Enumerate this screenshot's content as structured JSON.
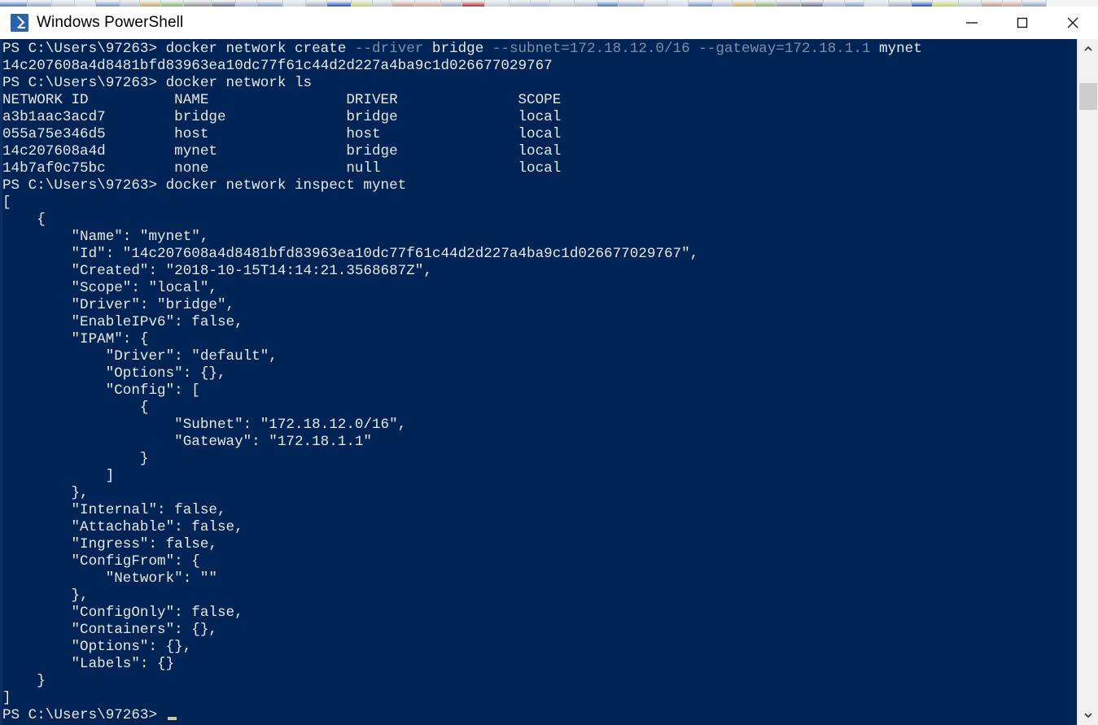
{
  "window": {
    "title": "Windows PowerShell",
    "icon": "powershell-icon",
    "controls": {
      "minimize": "minimize-icon",
      "maximize": "maximize-icon",
      "close": "close-icon"
    }
  },
  "theme": {
    "console_bg": "#012456",
    "console_fg": "#e8e8e8",
    "dim_fg": "#7d8fa8",
    "cursor": "#d6c79a",
    "titlebar_bg": "#ffffff",
    "scrollbar_bg": "#f0f0f0",
    "scrollbar_thumb": "#cdcdcd"
  },
  "scrollbar": {
    "up_arrow": "chevron-up-icon",
    "down_arrow": "chevron-down-icon",
    "thumb_position_percent": 4
  },
  "console": {
    "prompt": "PS C:\\Users\\97263>",
    "cursor_visible": true,
    "lines": [
      {
        "id": "cmd-create",
        "segments": [
          {
            "text": "PS C:\\Users\\97263> docker network create ",
            "style": "normal"
          },
          {
            "text": "--driver",
            "style": "dim"
          },
          {
            "text": " bridge ",
            "style": "normal"
          },
          {
            "text": "--subnet=172.18.12.0/16",
            "style": "dim"
          },
          {
            "text": " ",
            "style": "normal"
          },
          {
            "text": "--gateway=172.18.1.1",
            "style": "dim"
          },
          {
            "text": " mynet",
            "style": "normal"
          }
        ]
      },
      {
        "id": "created-id",
        "text": "14c207608a4d8481bfd83963ea10dc77f61c44d2d227a4ba9c1d026677029767"
      },
      {
        "id": "cmd-ls",
        "text": "PS C:\\Users\\97263> docker network ls"
      },
      {
        "id": "ls-header",
        "text": "NETWORK ID          NAME                DRIVER              SCOPE"
      },
      {
        "id": "ls-row-bridge",
        "text": "a3b1aac3acd7        bridge              bridge              local"
      },
      {
        "id": "ls-row-host",
        "text": "055a75e346d5        host                host                local"
      },
      {
        "id": "ls-row-mynet",
        "text": "14c207608a4d        mynet               bridge              local"
      },
      {
        "id": "ls-row-none",
        "text": "14b7af0c75bc        none                null                local"
      },
      {
        "id": "cmd-inspect",
        "text": "PS C:\\Users\\97263> docker network inspect mynet"
      },
      {
        "id": "json-open-array",
        "text": "["
      },
      {
        "id": "json-open-obj",
        "text": "    {"
      },
      {
        "id": "json-name",
        "text": "        \"Name\": \"mynet\","
      },
      {
        "id": "json-id",
        "text": "        \"Id\": \"14c207608a4d8481bfd83963ea10dc77f61c44d2d227a4ba9c1d026677029767\","
      },
      {
        "id": "json-created",
        "text": "        \"Created\": \"2018-10-15T14:14:21.3568687Z\","
      },
      {
        "id": "json-scope",
        "text": "        \"Scope\": \"local\","
      },
      {
        "id": "json-driver",
        "text": "        \"Driver\": \"bridge\","
      },
      {
        "id": "json-enableipv6",
        "text": "        \"EnableIPv6\": false,"
      },
      {
        "id": "json-ipam-open",
        "text": "        \"IPAM\": {"
      },
      {
        "id": "json-ipam-driver",
        "text": "            \"Driver\": \"default\","
      },
      {
        "id": "json-ipam-options",
        "text": "            \"Options\": {},"
      },
      {
        "id": "json-config-open",
        "text": "            \"Config\": ["
      },
      {
        "id": "json-config-obj-open",
        "text": "                {"
      },
      {
        "id": "json-subnet",
        "text": "                    \"Subnet\": \"172.18.12.0/16\","
      },
      {
        "id": "json-gateway",
        "text": "                    \"Gateway\": \"172.18.1.1\""
      },
      {
        "id": "json-config-obj-close",
        "text": "                }"
      },
      {
        "id": "json-config-close",
        "text": "            ]"
      },
      {
        "id": "json-ipam-close",
        "text": "        },"
      },
      {
        "id": "json-internal",
        "text": "        \"Internal\": false,"
      },
      {
        "id": "json-attachable",
        "text": "        \"Attachable\": false,"
      },
      {
        "id": "json-ingress",
        "text": "        \"Ingress\": false,"
      },
      {
        "id": "json-configfrom-open",
        "text": "        \"ConfigFrom\": {"
      },
      {
        "id": "json-configfrom-network",
        "text": "            \"Network\": \"\""
      },
      {
        "id": "json-configfrom-close",
        "text": "        },"
      },
      {
        "id": "json-configonly",
        "text": "        \"ConfigOnly\": false,"
      },
      {
        "id": "json-containers",
        "text": "        \"Containers\": {},"
      },
      {
        "id": "json-options",
        "text": "        \"Options\": {},"
      },
      {
        "id": "json-labels",
        "text": "        \"Labels\": {}"
      },
      {
        "id": "json-obj-close",
        "text": "    }"
      },
      {
        "id": "json-array-close",
        "text": "]"
      },
      {
        "id": "prompt-final",
        "text": "PS C:\\Users\\97263> ",
        "cursor": true
      }
    ]
  }
}
